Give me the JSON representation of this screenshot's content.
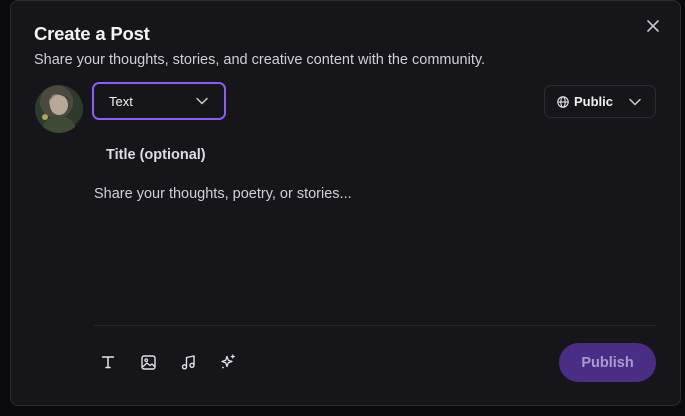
{
  "modal": {
    "title": "Create a Post",
    "subtitle": "Share your thoughts, stories, and creative content with the community."
  },
  "post_type": {
    "selected": "Text"
  },
  "visibility": {
    "selected": "Public"
  },
  "fields": {
    "title_placeholder": "Title (optional)",
    "body_placeholder": "Share your thoughts, poetry, or stories..."
  },
  "toolbar": {
    "icons": [
      "text-format-icon",
      "image-icon",
      "music-note-icon",
      "sparkles-icon"
    ]
  },
  "actions": {
    "publish_label": "Publish"
  },
  "colors": {
    "accent": "#8b5cf6",
    "publish_bg": "#4a2e86",
    "modal_bg": "#15151a"
  }
}
